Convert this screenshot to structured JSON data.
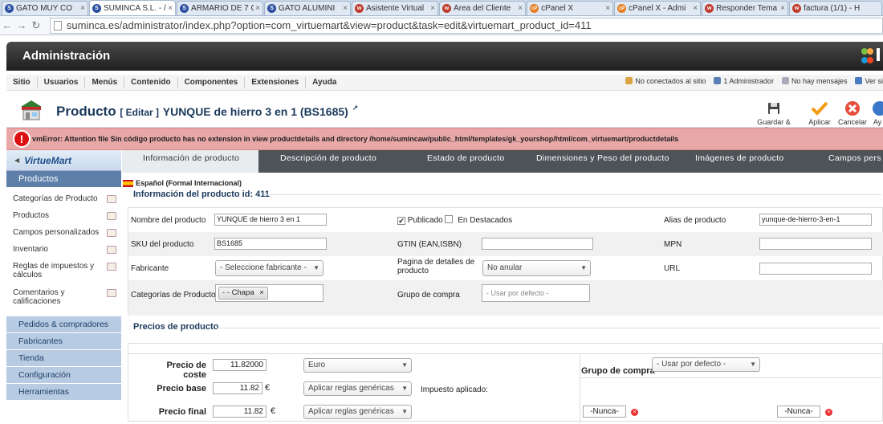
{
  "browser": {
    "tabs": [
      {
        "title": "GATO MUY CO",
        "color": "#2b4fa0",
        "letter": "S"
      },
      {
        "title": "SUMINCA S.L. - /",
        "color": "#2b4fa0",
        "letter": "S"
      },
      {
        "title": "ARMARIO DE 7 C",
        "color": "#2b4fa0",
        "letter": "S"
      },
      {
        "title": "GATO ALUMINI",
        "color": "#2b4fa0",
        "letter": "S"
      },
      {
        "title": "Asistente Virtual",
        "color": "#c0392b",
        "letter": "w"
      },
      {
        "title": "Área del Cliente",
        "color": "#c0392b",
        "letter": "w"
      },
      {
        "title": "cPanel X",
        "color": "#e67e22",
        "letter": "cP"
      },
      {
        "title": "cPanel X - Admi",
        "color": "#e67e22",
        "letter": "cP"
      },
      {
        "title": "Responder Tema",
        "color": "#c0392b",
        "letter": "w"
      },
      {
        "title": "factura (1/1) - H",
        "color": "#c0392b",
        "letter": "w"
      }
    ],
    "tab_close": "×",
    "url": "suminca.es/administrator/index.php?option=com_virtuemart&view=product&task=edit&virtuemart_product_id=411"
  },
  "admin": {
    "title": "Administración",
    "menu": [
      "Sitio",
      "Usuarios",
      "Menús",
      "Contenido",
      "Componentes",
      "Extensiones",
      "Ayuda"
    ],
    "status": [
      "No conectados al sitio",
      "1 Administrador",
      "No hay mensajes",
      "Ver si"
    ]
  },
  "toolbar": {
    "title": "Producto",
    "edit": "[ Editar ]",
    "product_name": "YUNQUE de hierro 3 en 1 (BS1685)",
    "save_close": "Guardar & Cerrar",
    "apply": "Aplicar",
    "cancel": "Cancelar",
    "help": "Ay"
  },
  "error": {
    "text": "vmError: Attention file Sin código producto has no extension in view productdetails and directory /home/sumincaw/public_html/templates/gk_yourshop/html/com_virtuemart/productdetails"
  },
  "sidebar": {
    "logo": "VirtueMart",
    "section": "Productos",
    "items": [
      "Categorías de Producto",
      "Productos",
      "Campos personalizados",
      "Inventario",
      "Reglas de impuestos y cálculos",
      "Comentarios y calificaciones"
    ],
    "sections": [
      "Pedidos & compradores",
      "Fabricantes",
      "Tienda",
      "Configuración",
      "Herramientas"
    ]
  },
  "tabs": [
    "Información de producto",
    "Descripción de producto",
    "Estado de producto",
    "Dimensiones y Peso del producto",
    "Imágenes de producto",
    "Campos pers"
  ],
  "form": {
    "language": "Español (Formal Internacional)",
    "info_title": "Información del producto id: 411",
    "name_label": "Nombre del producto",
    "name_value": "YUNQUE de hierro 3 en 1",
    "published_label": "Publicado",
    "featured_label": "En Destacados",
    "alias_label": "Alias de producto",
    "alias_value": "yunque-de-hierro-3-en-1",
    "sku_label": "SKU del producto",
    "sku_value": "BS1685",
    "gtin_label": "GTIN (EAN,ISBN)",
    "mpn_label": "MPN",
    "manufacturer_label": "Fabricante",
    "manufacturer_value": "- Seleccione fabricante -",
    "details_label": "Pagina de detalles de producto",
    "details_value": "No anular",
    "url_label": "URL",
    "categories_label": "Categorías de Producto",
    "category_chip": "- - Chapa",
    "chip_remove": "×",
    "group_label": "Grupo de compra",
    "group_placeholder": "- Usar por defecto -"
  },
  "prices": {
    "title": "Precios de producto",
    "cost_label": "Precio de coste",
    "cost_value": "11.82000",
    "currency": "Euro",
    "base_label": "Precio base",
    "base_value": "11.82",
    "euro_sign": "€",
    "rules_value": "Aplicar reglas genéricas",
    "tax_label": "Impuesto aplicado:",
    "final_label": "Precio final",
    "final_value": "11.82",
    "group_label": "Grupo de compra",
    "group_value": "- Usar por defecto -",
    "never1": "-Nunca-",
    "never2": "-Nunca-"
  }
}
